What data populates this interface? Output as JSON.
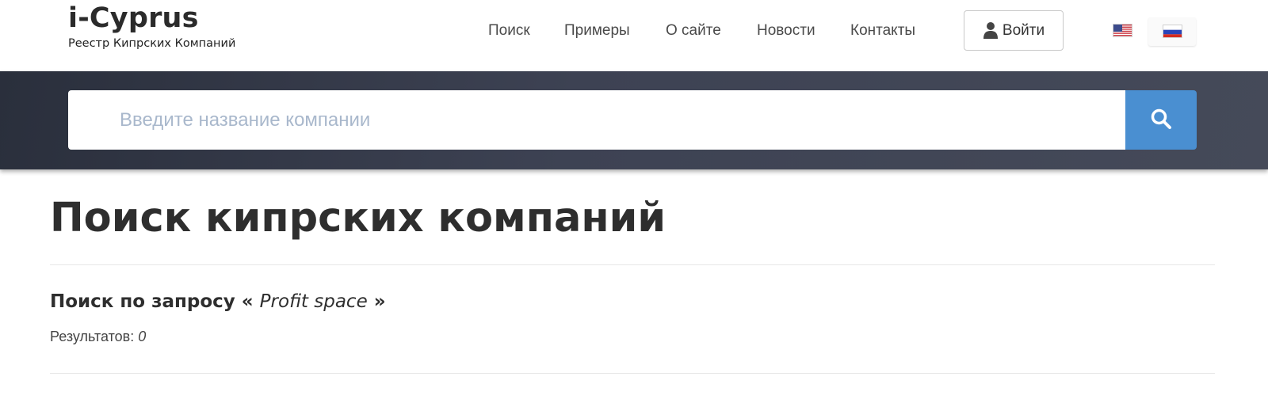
{
  "brand": {
    "title": "i-Cyprus",
    "subtitle": "Реестр Кипрских Компаний"
  },
  "nav": {
    "items": [
      {
        "label": "Поиск"
      },
      {
        "label": "Примеры"
      },
      {
        "label": "О сайте"
      },
      {
        "label": "Новости"
      },
      {
        "label": "Контакты"
      }
    ],
    "login_label": "Войти",
    "login_icon": "user-icon",
    "languages": [
      {
        "code": "en",
        "icon": "us-flag-icon"
      },
      {
        "code": "ru",
        "icon": "russia-flag-icon",
        "active": true
      }
    ]
  },
  "search": {
    "placeholder": "Введите название компании",
    "value": "",
    "button_icon": "search-icon"
  },
  "main": {
    "title": "Поиск кипрских компаний",
    "query_prefix": "Поиск по запросу «",
    "query_value": "Profit space",
    "query_suffix": "»",
    "results_label": "Результатов:",
    "results_count": "0"
  },
  "colors": {
    "band_dark": "#2a2f3c",
    "band_light": "#454a59",
    "search_button": "#4a8fd1",
    "placeholder": "#a9b8cc"
  }
}
